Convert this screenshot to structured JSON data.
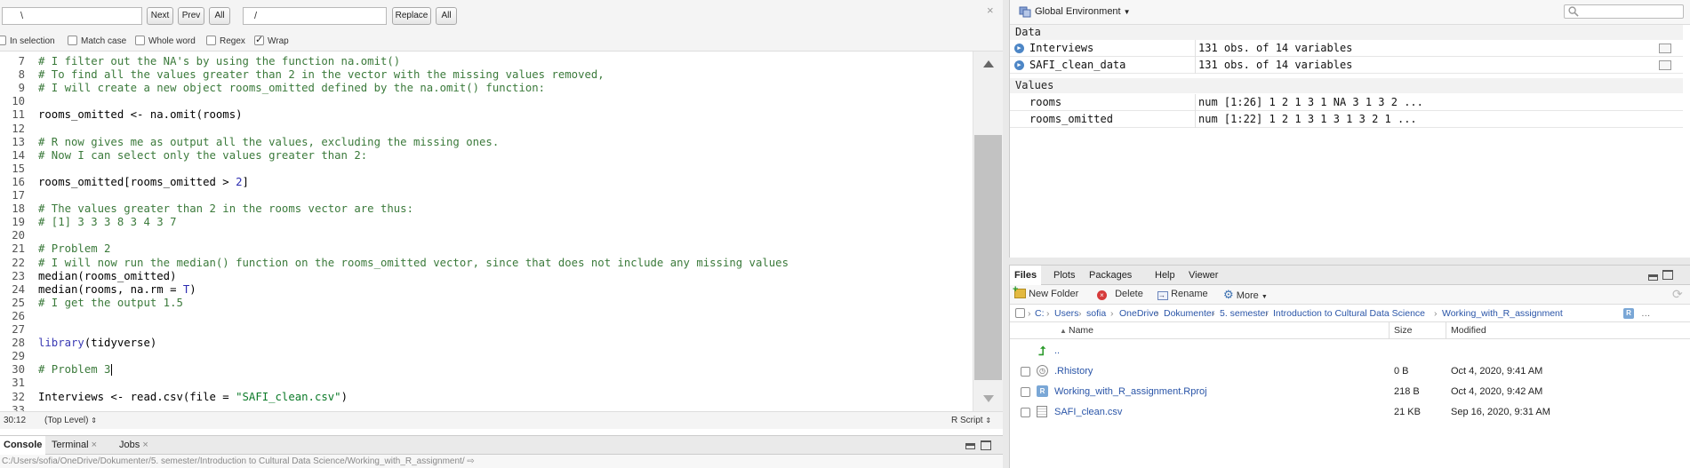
{
  "find_bar": {
    "find_value": "\\",
    "replace_value": "/",
    "next": "Next",
    "prev": "Prev",
    "all": "All",
    "replace": "Replace",
    "replace_all": "All",
    "options": {
      "in_selection": "In selection",
      "match_case": "Match case",
      "whole_word": "Whole word",
      "regex": "Regex",
      "wrap": "Wrap"
    }
  },
  "editor": {
    "lines": [
      {
        "n": "7",
        "t": "# I filter out the NA's by using the function na.omit()",
        "k": "cm"
      },
      {
        "n": "8",
        "t": "# To find all the values greater than 2 in the vector with the missing values removed,",
        "k": "cm"
      },
      {
        "n": "9",
        "t": "# I will create a new object rooms_omitted defined by the na.omit() function:",
        "k": "cm"
      },
      {
        "n": "10",
        "t": "",
        "k": ""
      },
      {
        "n": "11",
        "t": "rooms_omitted <- na.omit(rooms)",
        "k": ""
      },
      {
        "n": "12",
        "t": "",
        "k": ""
      },
      {
        "n": "13",
        "t": "# R now gives me as output all the values, excluding the missing ones.",
        "k": "cm"
      },
      {
        "n": "14",
        "t": "# Now I can select only the values greater than 2:",
        "k": "cm"
      },
      {
        "n": "15",
        "t": "",
        "k": ""
      },
      {
        "n": "16",
        "t": "rooms_omitted[rooms_omitted > 2]",
        "k": ""
      },
      {
        "n": "17",
        "t": "",
        "k": ""
      },
      {
        "n": "18",
        "t": "# The values greater than 2 in the rooms vector are thus:",
        "k": "cm"
      },
      {
        "n": "19",
        "t": "# [1] 3 3 3 8 3 4 3 7",
        "k": "cm"
      },
      {
        "n": "20",
        "t": "",
        "k": ""
      },
      {
        "n": "21",
        "t": "# Problem 2",
        "k": "cm"
      },
      {
        "n": "22",
        "t": "# I will now run the median() function on the rooms_omitted vector, since that does not include any missing values",
        "k": "cm"
      },
      {
        "n": "23",
        "t": "median(rooms_omitted)",
        "k": ""
      },
      {
        "n": "24",
        "t": "median(rooms, na.rm = T)",
        "k": ""
      },
      {
        "n": "25",
        "t": "# I get the output 1.5",
        "k": "cm"
      },
      {
        "n": "26",
        "t": "",
        "k": ""
      },
      {
        "n": "27",
        "t": "",
        "k": ""
      },
      {
        "n": "28",
        "t": "library(tidyverse)",
        "k": "lib"
      },
      {
        "n": "29",
        "t": "",
        "k": ""
      },
      {
        "n": "30",
        "t": "# Problem 3",
        "k": "cm"
      },
      {
        "n": "31",
        "t": "",
        "k": ""
      },
      {
        "n": "32",
        "t": "Interviews <- read.csv(file = \"SAFI_clean.csv\")",
        "k": "csv"
      },
      {
        "n": "33",
        "t": "",
        "k": ""
      }
    ],
    "cursor_position": "30:12",
    "scope": "(Top Level)",
    "file_type": "R Script"
  },
  "console": {
    "tabs": [
      "Console",
      "Terminal",
      "Jobs"
    ],
    "path": "C:/Users/sofia/OneDrive/Dokumenter/5. semester/Introduction to Cultural Data Science/Working_with_R_assignment/"
  },
  "environment": {
    "scope": "Global Environment",
    "data_header": "Data",
    "values_header": "Values",
    "data": [
      {
        "name": "Interviews",
        "value": "131 obs. of 14 variables"
      },
      {
        "name": "SAFI_clean_data",
        "value": "131 obs. of 14 variables"
      }
    ],
    "values": [
      {
        "name": "rooms",
        "value": "num [1:26] 1 2 1 3 1 NA 3 1 3 2 ..."
      },
      {
        "name": "rooms_omitted",
        "value": "num [1:22] 1 2 1 3 1 3 1 3 2 1 ..."
      }
    ]
  },
  "files_pane": {
    "tabs": [
      "Files",
      "Plots",
      "Packages",
      "Help",
      "Viewer"
    ],
    "toolbar": {
      "new_folder": "New Folder",
      "delete": "Delete",
      "rename": "Rename",
      "more": "More"
    },
    "breadcrumb": [
      "C:",
      "Users",
      "sofia",
      "OneDrive",
      "Dokumenter",
      "5. semester",
      "Introduction to Cultural Data Science",
      "Working_with_R_assignment"
    ],
    "columns": {
      "name": "Name",
      "size": "Size",
      "modified": "Modified"
    },
    "parent_dir": "..",
    "files": [
      {
        "name": ".Rhistory",
        "size": "0 B",
        "modified": "Oct 4, 2020, 9:41 AM",
        "icon": "rhistory-icon"
      },
      {
        "name": "Working_with_R_assignment.Rproj",
        "size": "218 B",
        "modified": "Oct 4, 2020, 9:42 AM",
        "icon": "rproj-icon"
      },
      {
        "name": "SAFI_clean.csv",
        "size": "21 KB",
        "modified": "Sep 16, 2020, 9:31 AM",
        "icon": "csv-file-icon"
      }
    ]
  },
  "colors": {
    "comment": "#3b7a3b",
    "function": "#3a3ab4",
    "string": "#0b7a28",
    "link": "#2a55a8"
  }
}
